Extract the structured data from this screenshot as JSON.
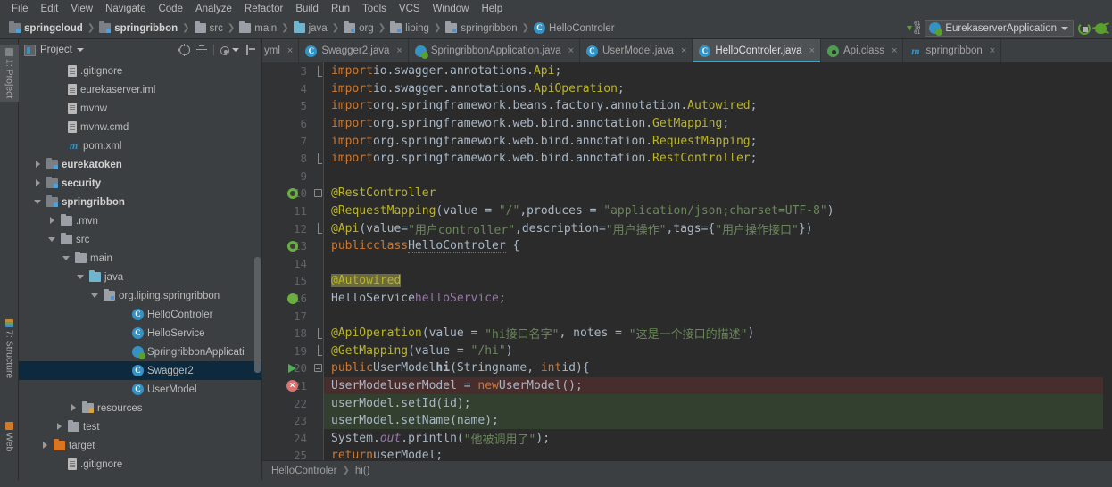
{
  "menubar": {
    "items": [
      "File",
      "Edit",
      "View",
      "Navigate",
      "Code",
      "Analyze",
      "Refactor",
      "Build",
      "Run",
      "Tools",
      "VCS",
      "Window",
      "Help"
    ]
  },
  "navbar": {
    "crumbs": [
      {
        "label": "springcloud",
        "icon": "module-icon",
        "bold": true
      },
      {
        "label": "springribbon",
        "icon": "module-icon",
        "bold": true
      },
      {
        "label": "src",
        "icon": "folder-icon",
        "bold": false
      },
      {
        "label": "main",
        "icon": "folder-icon",
        "bold": false
      },
      {
        "label": "java",
        "icon": "source-folder-icon",
        "bold": false
      },
      {
        "label": "org",
        "icon": "package-icon",
        "bold": false
      },
      {
        "label": "liping",
        "icon": "package-icon",
        "bold": false
      },
      {
        "label": "springribbon",
        "icon": "package-icon",
        "bold": false
      },
      {
        "label": "HelloControler",
        "icon": "class-icon",
        "bold": false
      }
    ],
    "run_config": "EurekaserverApplication",
    "run_icon": "spring-boot-run-icon",
    "debug_icon": "debug-bug-icon",
    "play_icon": "run-play-icon",
    "binary_icon": "binary-toggle-icon"
  },
  "toolstrip": {
    "buttons": [
      {
        "label": "1: Project",
        "icon": "project-icon",
        "active": true
      },
      {
        "label": "7: Structure",
        "icon": "structure-icon",
        "active": false
      },
      {
        "label": "Web",
        "icon": "web-icon",
        "active": false
      }
    ]
  },
  "project_panel": {
    "title": "Project",
    "title_icon": "project-view-icon",
    "toolbar_icons": [
      "locate-target-icon",
      "collapse-all-icon",
      "gear-icon",
      "hide-panel-icon"
    ],
    "tree": [
      {
        "label": ".gitignore",
        "icon": "file-icon",
        "indent": 5,
        "twisty": "none",
        "bold": false,
        "selected": false
      },
      {
        "label": "eurekaserver.iml",
        "icon": "file-icon",
        "indent": 5,
        "twisty": "none",
        "bold": false,
        "selected": false
      },
      {
        "label": "mvnw",
        "icon": "file-icon",
        "indent": 5,
        "twisty": "none",
        "bold": false,
        "selected": false
      },
      {
        "label": "mvnw.cmd",
        "icon": "file-icon",
        "indent": 5,
        "twisty": "none",
        "bold": false,
        "selected": false
      },
      {
        "label": "pom.xml",
        "icon": "maven-icon",
        "indent": 5,
        "twisty": "none",
        "bold": false,
        "selected": false
      },
      {
        "label": "eurekatoken",
        "icon": "module-icon",
        "indent": 2,
        "twisty": "right",
        "bold": true,
        "selected": false
      },
      {
        "label": "security",
        "icon": "module-icon",
        "indent": 2,
        "twisty": "right",
        "bold": true,
        "selected": false
      },
      {
        "label": "springribbon",
        "icon": "module-icon",
        "indent": 2,
        "twisty": "down",
        "bold": true,
        "selected": false
      },
      {
        "label": ".mvn",
        "icon": "folder-icon",
        "indent": 4,
        "twisty": "right",
        "bold": false,
        "selected": false
      },
      {
        "label": "src",
        "icon": "folder-icon",
        "indent": 4,
        "twisty": "down",
        "bold": false,
        "selected": false
      },
      {
        "label": "main",
        "icon": "folder-icon",
        "indent": 6,
        "twisty": "down",
        "bold": false,
        "selected": false
      },
      {
        "label": "java",
        "icon": "source-folder-icon",
        "indent": 8,
        "twisty": "down",
        "bold": false,
        "selected": false
      },
      {
        "label": "org.liping.springribbon",
        "icon": "package-icon",
        "indent": 10,
        "twisty": "down",
        "bold": false,
        "selected": false
      },
      {
        "label": "HelloControler",
        "icon": "class-icon",
        "indent": 14,
        "twisty": "none",
        "bold": false,
        "selected": false
      },
      {
        "label": "HelloService",
        "icon": "class-icon",
        "indent": 14,
        "twisty": "none",
        "bold": false,
        "selected": false
      },
      {
        "label": "SpringribbonApplicati",
        "icon": "spring-class-icon",
        "indent": 14,
        "twisty": "none",
        "bold": false,
        "selected": false
      },
      {
        "label": "Swagger2",
        "icon": "class-icon",
        "indent": 14,
        "twisty": "none",
        "bold": false,
        "selected": true
      },
      {
        "label": "UserModel",
        "icon": "class-icon",
        "indent": 14,
        "twisty": "none",
        "bold": false,
        "selected": false
      },
      {
        "label": "resources",
        "icon": "resources-folder-icon",
        "indent": 7,
        "twisty": "right",
        "bold": false,
        "selected": false
      },
      {
        "label": "test",
        "icon": "folder-icon",
        "indent": 5,
        "twisty": "right",
        "bold": false,
        "selected": false
      },
      {
        "label": "target",
        "icon": "target-folder-icon",
        "indent": 3,
        "twisty": "right",
        "bold": false,
        "selected": false
      },
      {
        "label": ".gitignore",
        "icon": "file-icon",
        "indent": 5,
        "twisty": "none",
        "bold": false,
        "selected": false
      }
    ]
  },
  "editor": {
    "tabs": [
      {
        "label": "yml",
        "icon": "yaml-icon",
        "active": false,
        "clipped": true
      },
      {
        "label": "Swagger2.java",
        "icon": "class-icon",
        "active": false,
        "clipped": false
      },
      {
        "label": "SpringribbonApplication.java",
        "icon": "spring-class-icon",
        "active": false,
        "clipped": false
      },
      {
        "label": "UserModel.java",
        "icon": "class-icon",
        "active": false,
        "clipped": false
      },
      {
        "label": "HelloControler.java",
        "icon": "class-icon",
        "active": true,
        "clipped": false
      },
      {
        "label": "Api.class",
        "icon": "compiled-class-icon",
        "active": false,
        "clipped": false
      },
      {
        "label": "springribbon",
        "icon": "maven-icon",
        "active": false,
        "clipped": false
      }
    ],
    "first_line": 3,
    "lines": [
      {
        "n": 3,
        "mark": "",
        "fold": "fold-end",
        "state": "normal"
      },
      {
        "n": 4,
        "mark": "",
        "fold": "",
        "state": "normal"
      },
      {
        "n": 5,
        "mark": "",
        "fold": "",
        "state": "normal"
      },
      {
        "n": 6,
        "mark": "",
        "fold": "",
        "state": "normal"
      },
      {
        "n": 7,
        "mark": "",
        "fold": "",
        "state": "normal"
      },
      {
        "n": 8,
        "mark": "",
        "fold": "fold-end",
        "state": "normal"
      },
      {
        "n": 9,
        "mark": "",
        "fold": "",
        "state": "normal"
      },
      {
        "n": 10,
        "mark": "spring-bean-icon",
        "fold": "fold-collapse",
        "state": "normal"
      },
      {
        "n": 11,
        "mark": "",
        "fold": "",
        "state": "normal"
      },
      {
        "n": 12,
        "mark": "",
        "fold": "fold-end",
        "state": "normal"
      },
      {
        "n": 13,
        "mark": "spring-config-icon",
        "fold": "",
        "state": "normal"
      },
      {
        "n": 14,
        "mark": "",
        "fold": "",
        "state": "normal"
      },
      {
        "n": 15,
        "mark": "",
        "fold": "",
        "state": "normal"
      },
      {
        "n": 16,
        "mark": "autowired-bean-icon",
        "fold": "",
        "state": "normal"
      },
      {
        "n": 17,
        "mark": "",
        "fold": "",
        "state": "normal"
      },
      {
        "n": 18,
        "mark": "",
        "fold": "fold-end",
        "state": "normal"
      },
      {
        "n": 19,
        "mark": "",
        "fold": "fold-end",
        "state": "normal"
      },
      {
        "n": 20,
        "mark": "run-method-icon",
        "fold": "fold-collapse",
        "state": "normal"
      },
      {
        "n": 21,
        "mark": "error-icon",
        "fold": "",
        "state": "error"
      },
      {
        "n": 22,
        "mark": "",
        "fold": "",
        "state": "changed"
      },
      {
        "n": 23,
        "mark": "",
        "fold": "",
        "state": "changed"
      },
      {
        "n": 24,
        "mark": "",
        "fold": "",
        "state": "normal"
      },
      {
        "n": 25,
        "mark": "",
        "fold": "",
        "state": "normal"
      }
    ],
    "code_text": [
      "import io.swagger.annotations.Api;",
      "import io.swagger.annotations.ApiOperation;",
      "import org.springframework.beans.factory.annotation.Autowired;",
      "import org.springframework.web.bind.annotation.GetMapping;",
      "import org.springframework.web.bind.annotation.RequestMapping;",
      "import org.springframework.web.bind.annotation.RestController;",
      "",
      "@RestController",
      "@RequestMapping(value = \"/\",produces = \"application/json;charset=UTF-8\")",
      "@Api(value=\"用户controller\",description=\"用户操作\",tags={\"用户操作接口\"})",
      "public class HelloControler {",
      "",
      "    @Autowired",
      "    HelloService helloService;",
      "",
      "    @ApiOperation(value = \"hi接口名字\", notes = \"这是一个接口的描述\")",
      "    @GetMapping(value = \"/hi\")",
      "    public UserModel hi(String name, int id){",
      "        UserModel userModel = new UserModel();",
      "        userModel.setId(id);",
      "        userModel.setName(name);",
      "        System.out.println(\"他被调用了\");",
      "        return userModel;"
    ],
    "breadcrumb": [
      {
        "label": "HelloControler"
      },
      {
        "label": "hi()"
      }
    ]
  },
  "colors": {
    "background": "#3c3f41",
    "editor_bg": "#2b2b2b",
    "gutter_bg": "#313335",
    "accent": "#3ea6c4",
    "selection": "#0d293e",
    "keyword": "#cc7832",
    "string": "#6a8759",
    "annotation": "#bbb529",
    "error_line": "#482d2d",
    "changed_line": "#33402f",
    "class_icon": "#3592c4",
    "spring_green": "#6aaf3f"
  }
}
